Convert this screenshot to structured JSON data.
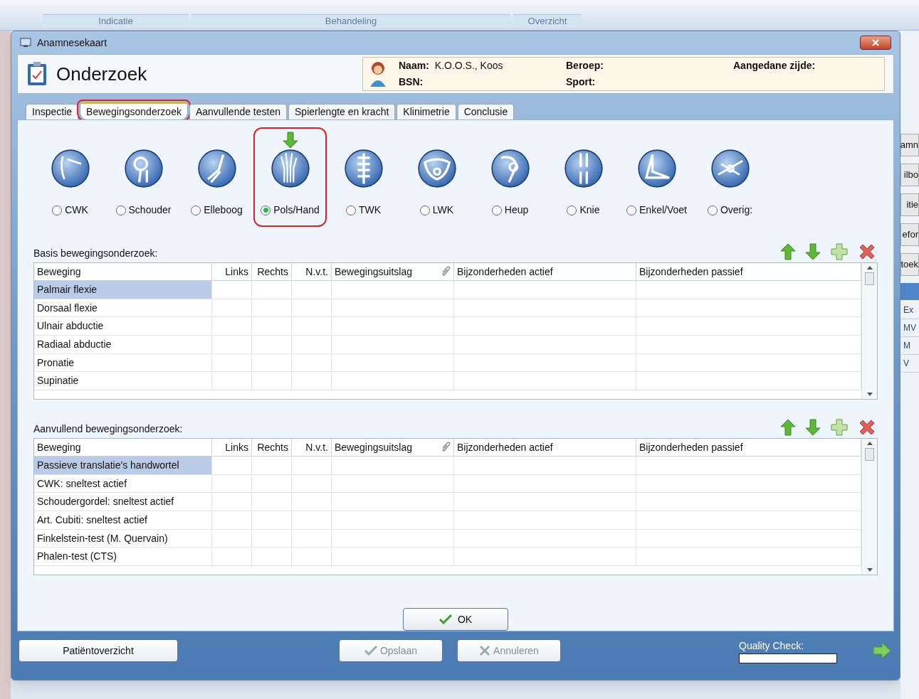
{
  "background_app": {
    "ribbon_groups": [
      {
        "label": "Indicatie"
      },
      {
        "label": "Behandeling"
      },
      {
        "label": "Overzicht"
      }
    ],
    "side_fragments": [
      "amn",
      "ilbo",
      "itie",
      "efor",
      "toek"
    ],
    "table_fragments": [
      "Ex",
      "MV",
      "M",
      "V"
    ]
  },
  "window": {
    "title": "Anamnesekaart"
  },
  "header": {
    "title": "Onderzoek",
    "patient": [
      {
        "label": "Naam:",
        "value": "K.O.O.S., Koos"
      },
      {
        "label": "Beroep:"
      },
      {
        "label": "Aangedane zijde:"
      },
      {
        "label": "BSN:"
      },
      {
        "label": "Sport:"
      }
    ]
  },
  "tabs": [
    {
      "label": "Inspectie",
      "selected": false,
      "highlighted": false
    },
    {
      "label": "Bewegingsonderzoek",
      "selected": true,
      "highlighted": true
    },
    {
      "label": "Aanvullende testen",
      "selected": false,
      "highlighted": false
    },
    {
      "label": "Spierlengte en kracht",
      "selected": false,
      "highlighted": false
    },
    {
      "label": "Klinimetrie",
      "selected": false,
      "highlighted": false
    },
    {
      "label": "Conclusie",
      "selected": false,
      "highlighted": false
    }
  ],
  "body_regions": [
    {
      "label": "CWK",
      "selected": false,
      "highlighted": false
    },
    {
      "label": "Schouder",
      "selected": false,
      "highlighted": false
    },
    {
      "label": "Elleboog",
      "selected": false,
      "highlighted": false
    },
    {
      "label": "Pols/Hand",
      "selected": true,
      "highlighted": true
    },
    {
      "label": "TWK",
      "selected": false,
      "highlighted": false
    },
    {
      "label": "LWK",
      "selected": false,
      "highlighted": false
    },
    {
      "label": "Heup",
      "selected": false,
      "highlighted": false
    },
    {
      "label": "Knie",
      "selected": false,
      "highlighted": false
    },
    {
      "label": "Enkel/Voet",
      "selected": false,
      "highlighted": false
    },
    {
      "label": "Overig:",
      "selected": false,
      "highlighted": false
    }
  ],
  "sections": [
    {
      "title": "Basis bewegingsonderzoek:",
      "columns": [
        "Beweging",
        "Links",
        "Rechts",
        "N.v.t.",
        "Bewegingsuitslag",
        "Bijzonderheden actief",
        "Bijzonderheden passief"
      ],
      "rows": [
        {
          "name": "Palmair flexie",
          "selected": true
        },
        {
          "name": "Dorsaal flexie",
          "selected": false
        },
        {
          "name": "Ulnair abductie",
          "selected": false
        },
        {
          "name": "Radiaal abductie",
          "selected": false
        },
        {
          "name": "Pronatie",
          "selected": false
        },
        {
          "name": "Supinatie",
          "selected": false
        }
      ]
    },
    {
      "title": "Aanvullend bewegingsonderzoek:",
      "columns": [
        "Beweging",
        "Links",
        "Rechts",
        "N.v.t.",
        "Bewegingsuitslag",
        "Bijzonderheden actief",
        "Bijzonderheden passief"
      ],
      "rows": [
        {
          "name": "Passieve translatie's handwortel",
          "selected": true
        },
        {
          "name": "CWK: sneltest actief",
          "selected": false
        },
        {
          "name": "Schoudergordel: sneltest actief",
          "selected": false
        },
        {
          "name": "Art. Cubiti: sneltest actief",
          "selected": false
        },
        {
          "name": "Finkelstein-test (M. Quervain)",
          "selected": false
        },
        {
          "name": "Phalen-test (CTS)",
          "selected": false
        }
      ]
    }
  ],
  "ok_button": {
    "label": "OK"
  },
  "footer": {
    "buttons": [
      {
        "label": "Patiëntoverzicht",
        "disabled": false,
        "kind": "plain"
      },
      {
        "label": "Opslaan",
        "disabled": true,
        "kind": "save"
      },
      {
        "label": "Annuleren",
        "disabled": true,
        "kind": "cancel"
      }
    ],
    "quality_check": {
      "label": "Quality Check:"
    }
  }
}
